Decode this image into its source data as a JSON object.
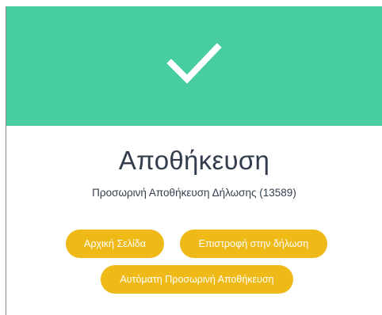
{
  "dialog": {
    "status_icon": "checkmark-icon",
    "header_color": "#48cca2",
    "title": "Αποθήκευση",
    "subtitle": "Προσωρινή Αποθήκευση Δήλωσης (13589)"
  },
  "buttons": {
    "home_label": "Αρχική Σελίδα",
    "return_label": "Επιστροφή στην δήλωση",
    "auto_save_label": "Αυτόματη Προσωρινή Αποθήκευση",
    "color": "#efb918"
  }
}
